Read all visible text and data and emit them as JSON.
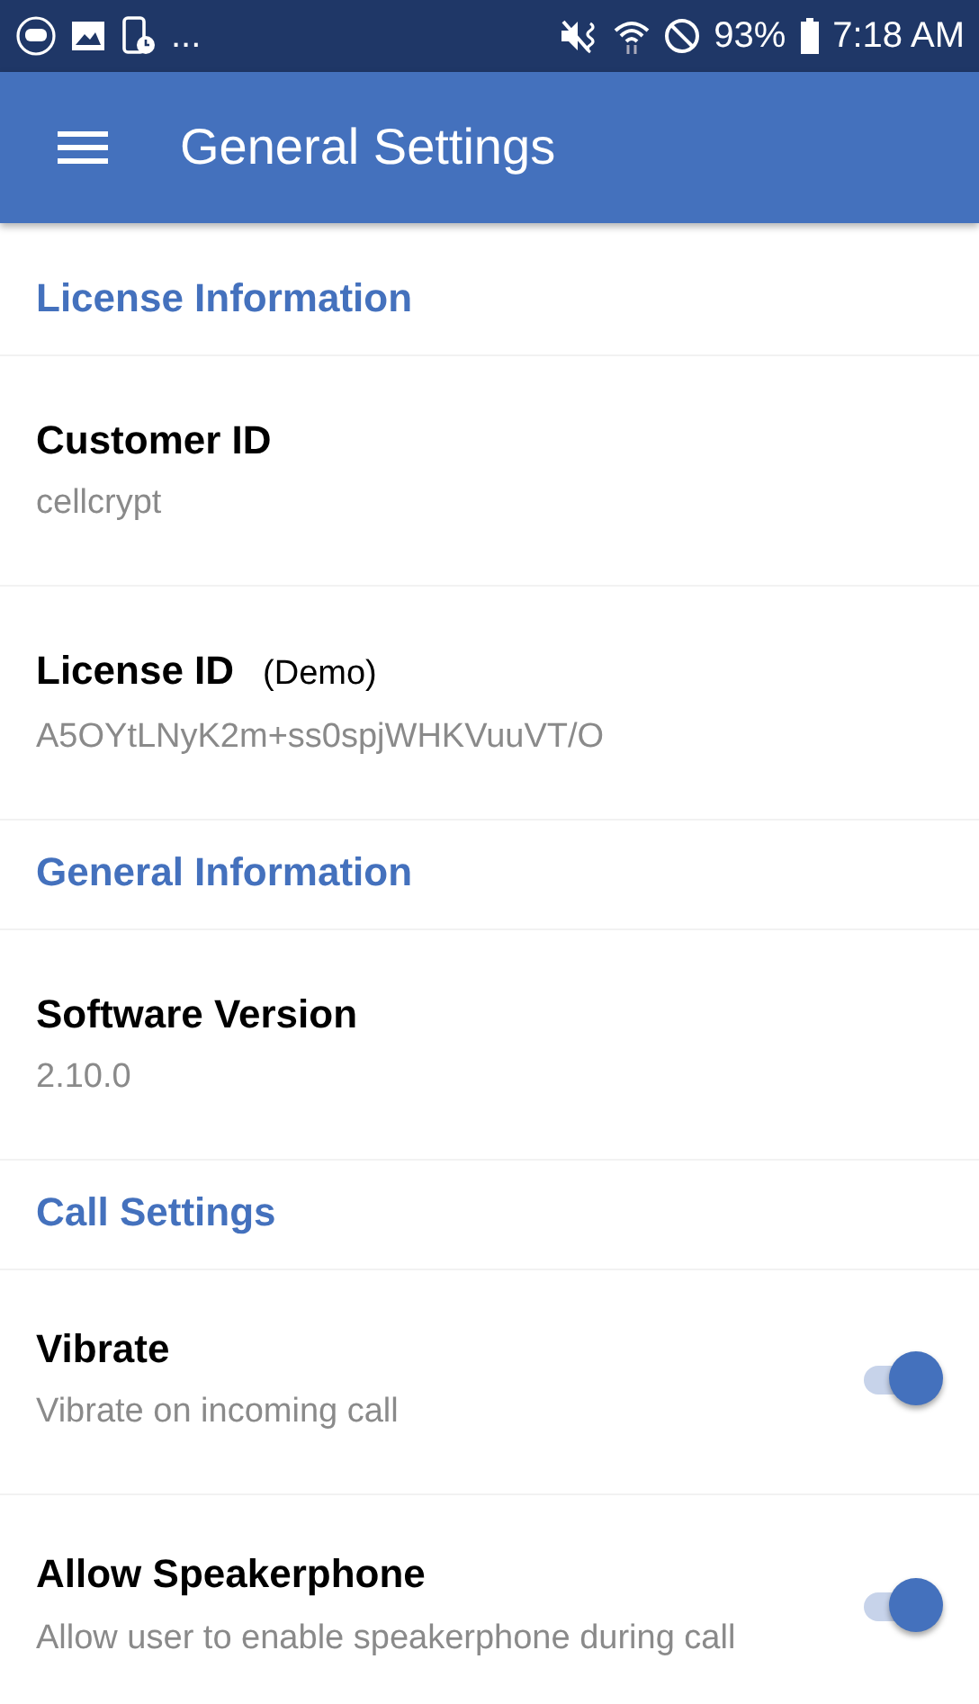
{
  "status_bar": {
    "overflow": "...",
    "battery": "93%",
    "time": "7:18 AM"
  },
  "app_bar": {
    "title": "General Settings"
  },
  "sections": [
    {
      "title": "License Information",
      "items": [
        {
          "kind": "text",
          "title": "Customer ID",
          "value": "cellcrypt"
        },
        {
          "kind": "text",
          "title": "License ID",
          "note": "(Demo)",
          "value": "A5OYtLNyK2m+ss0spjWHKVuuVT/O"
        }
      ]
    },
    {
      "title": "General Information",
      "items": [
        {
          "kind": "text",
          "title": "Software Version",
          "value": "2.10.0"
        }
      ]
    },
    {
      "title": "Call Settings",
      "items": [
        {
          "kind": "toggle",
          "title": "Vibrate",
          "summary": "Vibrate on incoming call",
          "on": true
        },
        {
          "kind": "toggle",
          "title": "Allow Speakerphone",
          "summary": "Allow user to enable speakerphone during call",
          "on": true
        }
      ]
    }
  ]
}
